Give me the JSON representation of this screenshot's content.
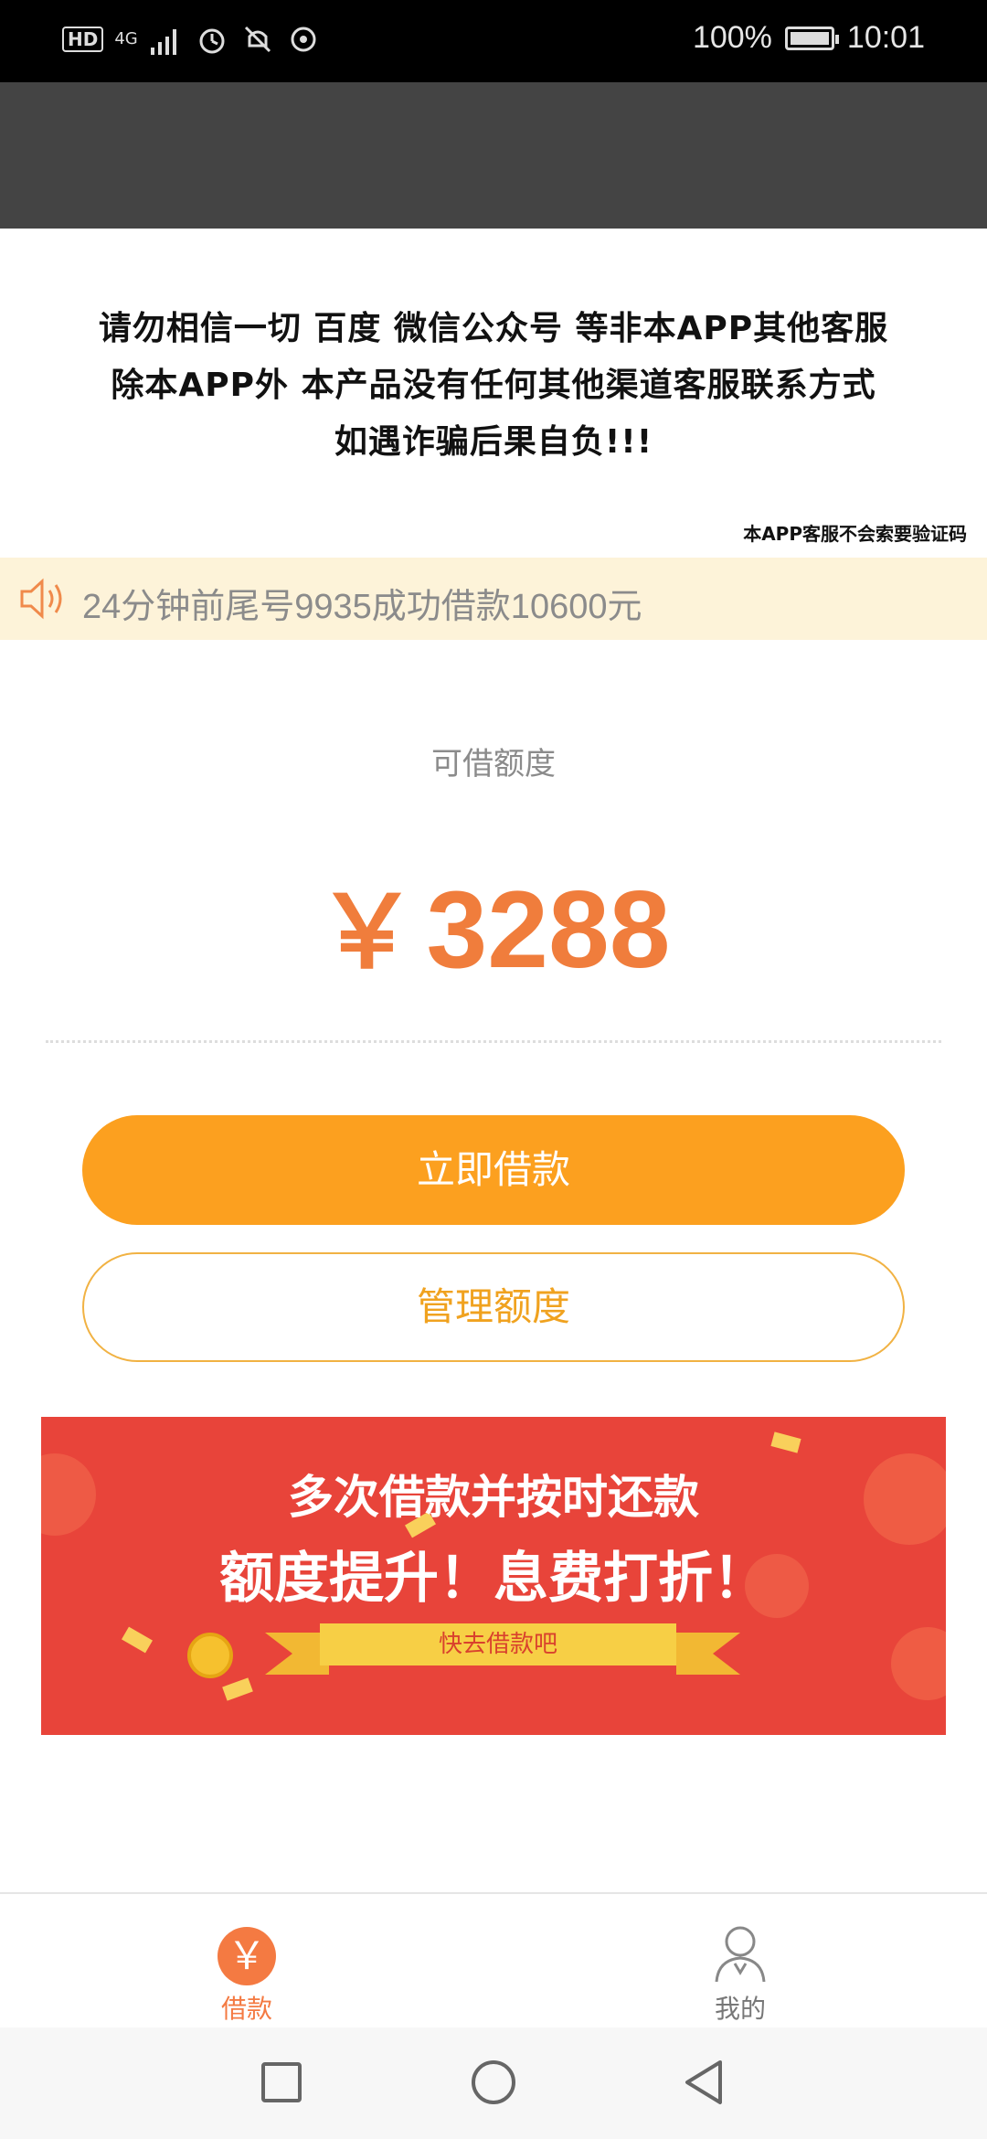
{
  "status_bar": {
    "hd": "HD",
    "network": "4G",
    "battery_pct": "100%",
    "time": "10:01",
    "icons": [
      "signal-icon",
      "alarm-icon",
      "mute-icon",
      "sync-icon",
      "battery-icon"
    ]
  },
  "notice": {
    "line1": "请勿相信一切 百度 微信公众号 等非本APP其他客服",
    "line2": "除本APP外 本产品没有任何其他渠道客服联系方式",
    "line3": "如遇诈骗后果自负!!!",
    "small": "本APP客服不会索要验证码"
  },
  "marquee": {
    "icon": "speaker-icon",
    "text": "24分钟前尾号9935成功借款10600元"
  },
  "limit": {
    "label": "可借额度",
    "currency": "￥",
    "amount": "3288"
  },
  "buttons": {
    "borrow_now": "立即借款",
    "manage_limit": "管理额度"
  },
  "banner": {
    "line1": "多次借款并按时还款",
    "line2": "额度提升！息费打折！",
    "ribbon": "快去借款吧"
  },
  "tabbar": {
    "loan_icon": "￥",
    "loan_label": "借款",
    "me_label": "我的"
  },
  "colors": {
    "accent": "#f07d3c",
    "primary_button": "#fca01f",
    "banner_red": "#e8443a",
    "marquee_bg": "#fdf3d9",
    "header_bg": "#444444"
  }
}
